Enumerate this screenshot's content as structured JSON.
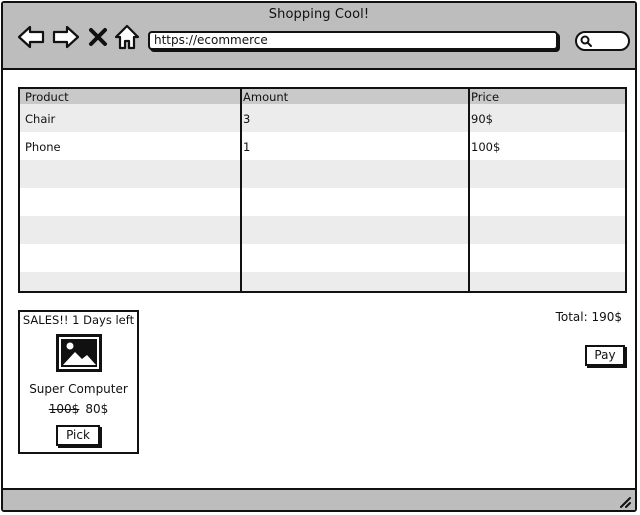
{
  "window": {
    "title": "Shopping Cool!"
  },
  "toolbar": {
    "url": "https://ecommerce",
    "icons": [
      "back-arrow-icon",
      "forward-arrow-icon",
      "close-x-icon",
      "home-icon",
      "search-icon"
    ]
  },
  "cart": {
    "columns": [
      "Product",
      "Amount",
      "Price"
    ],
    "rows": [
      {
        "product": "Chair",
        "amount": "3",
        "price": "90$"
      },
      {
        "product": "Phone",
        "amount": "1",
        "price": "100$"
      }
    ]
  },
  "sale": {
    "title": "SALES!! 1 Days left",
    "product_name": "Super Computer",
    "old_price": "100$",
    "new_price": "80$",
    "pick_label": "Pick",
    "image_icon": "image-placeholder-icon"
  },
  "checkout": {
    "total": "Total: 190$",
    "pay_label": "Pay"
  }
}
